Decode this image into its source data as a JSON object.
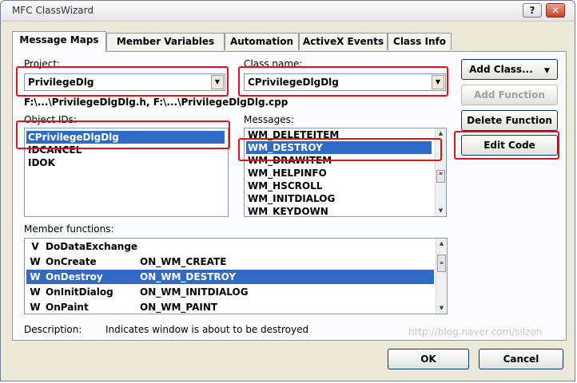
{
  "window": {
    "title": "MFC ClassWizard",
    "help_glyph": "?",
    "close_glyph": "✕"
  },
  "tabs": [
    "Message Maps",
    "Member Variables",
    "Automation",
    "ActiveX Events",
    "Class Info"
  ],
  "project": {
    "label": "Project:",
    "value": "PrivilegeDlg"
  },
  "class_name": {
    "label": "Class name:",
    "value": "CPrivilegeDlgDlg"
  },
  "files_path": "F:\\...\\PrivilegeDlgDlg.h, F:\\...\\PrivilegeDlgDlg.cpp",
  "object_ids": {
    "label": "Object IDs:",
    "items": [
      "CPrivilegeDlgDlg",
      "IDCANCEL",
      "IDOK"
    ],
    "selected": 0
  },
  "messages": {
    "label": "Messages:",
    "items": [
      "WM_DELETEITEM",
      "WM_DESTROY",
      "WM_DRAWITEM",
      "WM_HELPINFO",
      "WM_HSCROLL",
      "WM_INITDIALOG",
      "WM_KEYDOWN"
    ],
    "selected": 1
  },
  "member_functions": {
    "label": "Member functions:",
    "rows": [
      {
        "kind": "V",
        "name": "DoDataExchange",
        "map": ""
      },
      {
        "kind": "W",
        "name": "OnCreate",
        "map": "ON_WM_CREATE"
      },
      {
        "kind": "W",
        "name": "OnDestroy",
        "map": "ON_WM_DESTROY"
      },
      {
        "kind": "W",
        "name": "OnInitDialog",
        "map": "ON_WM_INITDIALOG"
      },
      {
        "kind": "W",
        "name": "OnPaint",
        "map": "ON_WM_PAINT"
      }
    ],
    "selected": 2
  },
  "description": {
    "label": "Description:",
    "text": "Indicates window is about to be destroyed"
  },
  "buttons": {
    "add_class": "Add Class...",
    "add_class_arrow": "▼",
    "add_function": "Add Function",
    "delete_function": "Delete Function",
    "edit_code": "Edit Code",
    "ok": "OK",
    "cancel": "Cancel"
  },
  "watermark": "http://blog.naver.com/silzon",
  "colors": {
    "highlight": "#e0121a",
    "selection": "#316ac5"
  }
}
